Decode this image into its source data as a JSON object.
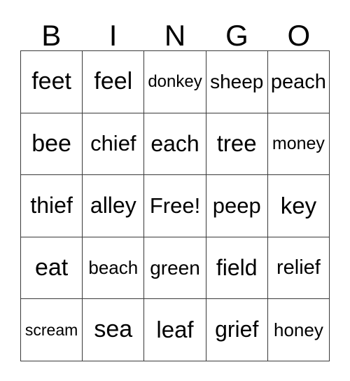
{
  "card": {
    "title": "BINGO",
    "header_letters": [
      "B",
      "I",
      "N",
      "G",
      "O"
    ],
    "free_space_label": "Free!",
    "colors": {
      "border": "#3a3a3a",
      "text": "#000000",
      "background": "#ffffff"
    },
    "rows": [
      [
        {
          "label": "feet",
          "font_size": "34px"
        },
        {
          "label": "feel",
          "font_size": "34px"
        },
        {
          "label": "donkey",
          "font_size": "24px"
        },
        {
          "label": "sheep",
          "font_size": "28px"
        },
        {
          "label": "peach",
          "font_size": "29px"
        }
      ],
      [
        {
          "label": "bee",
          "font_size": "34px"
        },
        {
          "label": "chief",
          "font_size": "31px"
        },
        {
          "label": "each",
          "font_size": "32px"
        },
        {
          "label": "tree",
          "font_size": "33px"
        },
        {
          "label": "money",
          "font_size": "25px"
        }
      ],
      [
        {
          "label": "thief",
          "font_size": "32px"
        },
        {
          "label": "alley",
          "font_size": "32px"
        },
        {
          "label": "Free!",
          "font_size": "31px"
        },
        {
          "label": "peep",
          "font_size": "31px"
        },
        {
          "label": "key",
          "font_size": "33px"
        }
      ],
      [
        {
          "label": "eat",
          "font_size": "34px"
        },
        {
          "label": "beach",
          "font_size": "26px"
        },
        {
          "label": "green",
          "font_size": "28px"
        },
        {
          "label": "field",
          "font_size": "32px"
        },
        {
          "label": "relief",
          "font_size": "29px"
        }
      ],
      [
        {
          "label": "scream",
          "font_size": "23px"
        },
        {
          "label": "sea",
          "font_size": "34px"
        },
        {
          "label": "leaf",
          "font_size": "33px"
        },
        {
          "label": "grief",
          "font_size": "32px"
        },
        {
          "label": "honey",
          "font_size": "26px"
        }
      ]
    ]
  }
}
